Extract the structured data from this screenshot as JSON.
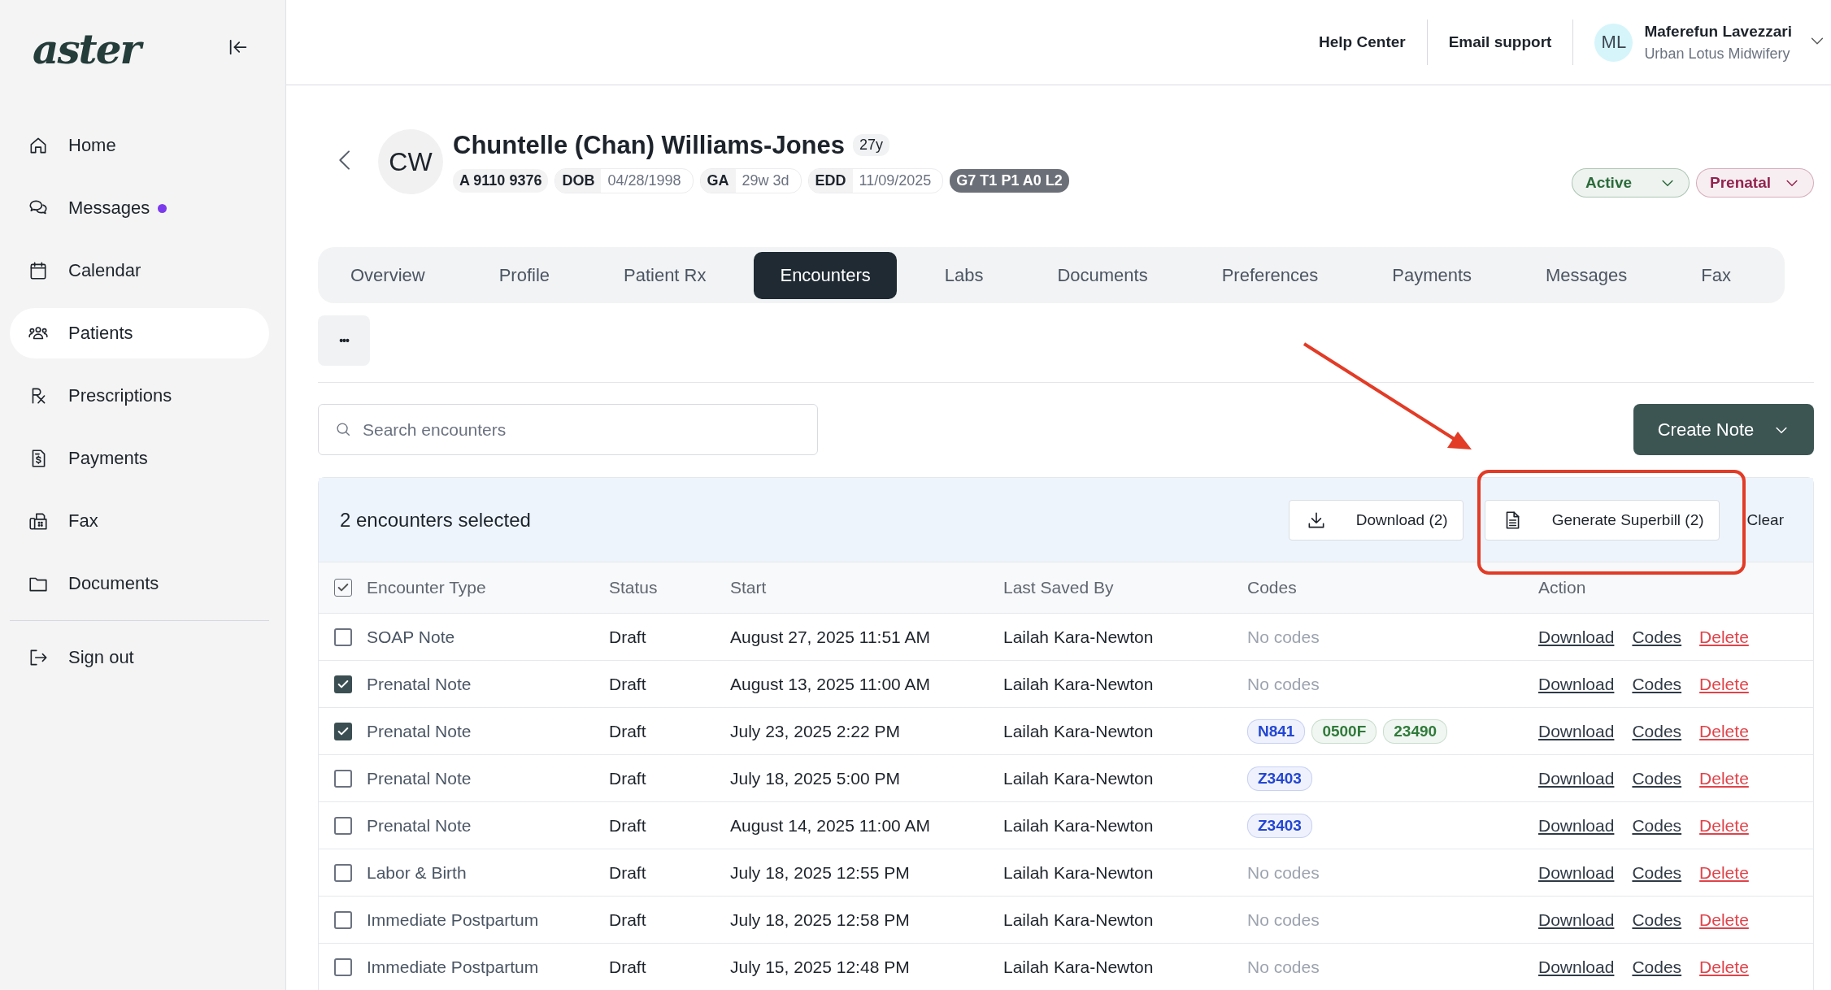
{
  "sidebar": {
    "logo": "aster",
    "items": [
      {
        "label": "Home",
        "selected": false,
        "unread": false
      },
      {
        "label": "Messages",
        "selected": false,
        "unread": true
      },
      {
        "label": "Calendar",
        "selected": false,
        "unread": false
      },
      {
        "label": "Patients",
        "selected": true,
        "unread": false
      },
      {
        "label": "Prescriptions",
        "selected": false,
        "unread": false
      },
      {
        "label": "Payments",
        "selected": false,
        "unread": false
      },
      {
        "label": "Fax",
        "selected": false,
        "unread": false
      },
      {
        "label": "Documents",
        "selected": false,
        "unread": false
      }
    ],
    "sign_out": "Sign out"
  },
  "top_bar": {
    "links": [
      "Help Center",
      "Email support"
    ],
    "user": {
      "initials": "ML",
      "name": "Maferefun Lavezzari",
      "practice": "Urban Lotus Midwifery"
    }
  },
  "patient": {
    "initials": "CW",
    "name": "Chuntelle (Chan) Williams-Jones",
    "age": "27y",
    "mrn": "A 9110 9376",
    "facts": [
      {
        "label": "DOB",
        "value": "04/28/1998"
      },
      {
        "label": "GA",
        "value": "29w 3d"
      },
      {
        "label": "EDD",
        "value": "11/09/2025"
      }
    ],
    "obstetric": "G7 T1 P1 A0 L2",
    "status_pills": [
      {
        "label": "Active",
        "color": "#2b6b3a"
      },
      {
        "label": "Prenatal",
        "color": "#93244f"
      }
    ]
  },
  "tabs": [
    {
      "label": "Overview",
      "selected": false
    },
    {
      "label": "Profile",
      "selected": false
    },
    {
      "label": "Patient Rx",
      "selected": false
    },
    {
      "label": "Encounters",
      "selected": true
    },
    {
      "label": "Labs",
      "selected": false
    },
    {
      "label": "Documents",
      "selected": false
    },
    {
      "label": "Preferences",
      "selected": false
    },
    {
      "label": "Payments",
      "selected": false
    },
    {
      "label": "Messages",
      "selected": false
    },
    {
      "label": "Fax",
      "selected": false
    }
  ],
  "more_button": "•••",
  "search": {
    "placeholder": "Search encounters"
  },
  "create_button": "Create Note",
  "selection": {
    "text": "2 encounters selected",
    "download": "Download (2)",
    "superbill": "Generate Superbill (2)",
    "clear": "Clear"
  },
  "table": {
    "select_all": {
      "checked": true
    },
    "columns": [
      "Encounter Type",
      "Status",
      "Start",
      "Last Saved By",
      "Codes",
      "Action"
    ],
    "rows": [
      {
        "selected": false,
        "type": "SOAP Note",
        "status": "Draft",
        "start": "August 27, 2025 11:51 AM",
        "saved_by": "Lailah Kara-Newton",
        "codes": [],
        "codes_note": "No codes",
        "actions": [
          {
            "label": "Download",
            "kind": "link"
          },
          {
            "label": "Codes",
            "kind": "link"
          },
          {
            "label": "Delete",
            "kind": "danger"
          }
        ]
      },
      {
        "selected": true,
        "type": "Prenatal Note",
        "status": "Draft",
        "start": "August 13, 2025 11:00 AM",
        "saved_by": "Lailah Kara-Newton",
        "codes": [],
        "codes_note": "No codes",
        "actions": [
          {
            "label": "Download",
            "kind": "link"
          },
          {
            "label": "Codes",
            "kind": "link"
          },
          {
            "label": "Delete",
            "kind": "danger"
          }
        ]
      },
      {
        "selected": true,
        "type": "Prenatal Note",
        "status": "Draft",
        "start": "July 23, 2025 2:22 PM",
        "saved_by": "Lailah Kara-Newton",
        "codes": [
          {
            "label": "N841",
            "color": "#2346d3"
          },
          {
            "label": "0500F",
            "color": "#2f7a3a"
          },
          {
            "label": "23490",
            "color": "#2f7a3a"
          }
        ],
        "actions": [
          {
            "label": "Download",
            "kind": "link"
          },
          {
            "label": "Codes",
            "kind": "link"
          },
          {
            "label": "Delete",
            "kind": "danger"
          }
        ]
      },
      {
        "selected": false,
        "type": "Prenatal Note",
        "status": "Draft",
        "start": "July 18, 2025 5:00 PM",
        "saved_by": "Lailah Kara-Newton",
        "codes": [
          {
            "label": "Z3403",
            "color": "#2346d3"
          }
        ],
        "actions": [
          {
            "label": "Download",
            "kind": "link"
          },
          {
            "label": "Codes",
            "kind": "link"
          },
          {
            "label": "Delete",
            "kind": "danger"
          }
        ]
      },
      {
        "selected": false,
        "type": "Prenatal Note",
        "status": "Draft",
        "start": "August 14, 2025 11:00 AM",
        "saved_by": "Lailah Kara-Newton",
        "codes": [
          {
            "label": "Z3403",
            "color": "#2346d3"
          }
        ],
        "actions": [
          {
            "label": "Download",
            "kind": "link"
          },
          {
            "label": "Codes",
            "kind": "link"
          },
          {
            "label": "Delete",
            "kind": "danger"
          }
        ]
      },
      {
        "selected": false,
        "type": "Labor & Birth",
        "status": "Draft",
        "start": "July 18, 2025 12:55 PM",
        "saved_by": "Lailah Kara-Newton",
        "codes": [],
        "codes_note": "No codes",
        "actions": [
          {
            "label": "Download",
            "kind": "link"
          },
          {
            "label": "Codes",
            "kind": "link"
          },
          {
            "label": "Delete",
            "kind": "danger"
          }
        ]
      },
      {
        "selected": false,
        "type": "Immediate Postpartum",
        "status": "Draft",
        "start": "July 18, 2025 12:58 PM",
        "saved_by": "Lailah Kara-Newton",
        "codes": [],
        "codes_note": "No codes",
        "actions": [
          {
            "label": "Download",
            "kind": "link"
          },
          {
            "label": "Codes",
            "kind": "link"
          },
          {
            "label": "Delete",
            "kind": "danger"
          }
        ]
      },
      {
        "selected": false,
        "type": "Immediate Postpartum",
        "status": "Draft",
        "start": "July 15, 2025 12:48 PM",
        "saved_by": "Lailah Kara-Newton",
        "codes": [],
        "codes_note": "No codes",
        "actions": [
          {
            "label": "Download",
            "kind": "link"
          },
          {
            "label": "Codes",
            "kind": "link"
          },
          {
            "label": "Delete",
            "kind": "danger"
          }
        ]
      }
    ]
  }
}
